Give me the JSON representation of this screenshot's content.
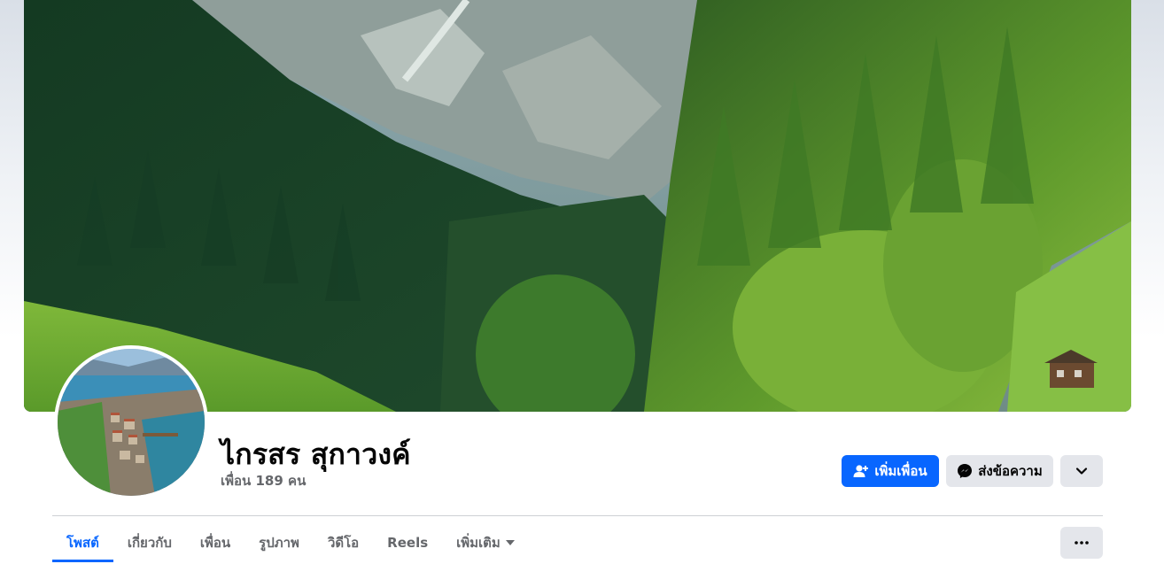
{
  "profile": {
    "name": "ไกรสร สุกาวงค์",
    "friends_text": "เพื่อน 189 คน"
  },
  "actions": {
    "add_friend_label": "เพิ่มเพื่อน",
    "message_label": "ส่งข้อความ",
    "add_friend_icon": "add-friend-icon",
    "messenger_icon": "messenger-icon",
    "chevron_icon": "chevron-down-icon"
  },
  "tabs": [
    {
      "label": "โพสต์",
      "active": true
    },
    {
      "label": "เกี่ยวกับ",
      "active": false
    },
    {
      "label": "เพื่อน",
      "active": false
    },
    {
      "label": "รูปภาพ",
      "active": false
    },
    {
      "label": "วิดีโอ",
      "active": false
    },
    {
      "label": "Reels",
      "active": false
    },
    {
      "label": "เพิ่มเติม",
      "active": false
    }
  ],
  "colors": {
    "primary": "#0866ff",
    "secondary_button": "#e4e6eb",
    "muted_text": "#65676b"
  }
}
